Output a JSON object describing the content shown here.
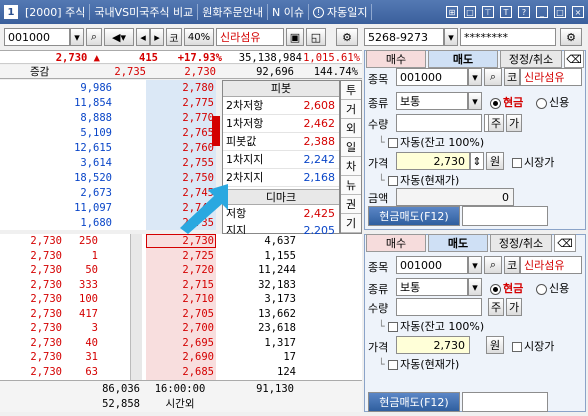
{
  "titlebar": {
    "win_no": "1",
    "screen": "[2000] 주식",
    "tabs": [
      "국내VS미국주식 비교",
      "원화주문안내",
      "N 이슈",
      "자동일지"
    ]
  },
  "toolbar": {
    "code": "001000",
    "stock_flag": "코",
    "margin": "40%",
    "stock_name": "신라섬유",
    "account": "5268-9273",
    "password": "********"
  },
  "summary": {
    "price": "2,730",
    "change": "415",
    "pct": "+17.93%",
    "volume": "35,138,984",
    "other": "1,015.61%",
    "label_change": "증감",
    "ref_price": "2,735",
    "cur_price": "2,730",
    "vol2": "92,696",
    "vol_ratio": "144.74%"
  },
  "asks": [
    {
      "qty": "9,986",
      "price": "2,780"
    },
    {
      "qty": "11,854",
      "price": "2,775"
    },
    {
      "qty": "8,888",
      "price": "2,770"
    },
    {
      "qty": "5,109",
      "price": "2,765"
    },
    {
      "qty": "12,615",
      "price": "2,760"
    },
    {
      "qty": "3,614",
      "price": "2,755"
    },
    {
      "qty": "18,520",
      "price": "2,750"
    },
    {
      "qty": "2,673",
      "price": "2,745"
    },
    {
      "qty": "11,097",
      "price": "2,740"
    },
    {
      "qty": "1,680",
      "price": "2,735"
    }
  ],
  "bids": [
    {
      "price": "2,730",
      "qty": "4,637"
    },
    {
      "price": "2,725",
      "qty": "1,155"
    },
    {
      "price": "2,720",
      "qty": "11,244"
    },
    {
      "price": "2,715",
      "qty": "32,183"
    },
    {
      "price": "2,710",
      "qty": "3,173"
    },
    {
      "price": "2,705",
      "qty": "13,662"
    },
    {
      "price": "2,700",
      "qty": "23,618"
    },
    {
      "price": "2,695",
      "qty": "1,317"
    },
    {
      "price": "2,690",
      "qty": "17"
    },
    {
      "price": "2,685",
      "qty": "124"
    }
  ],
  "trades": [
    {
      "price": "2,730",
      "qty": "250"
    },
    {
      "price": "2,730",
      "qty": "1"
    },
    {
      "price": "2,730",
      "qty": "50"
    },
    {
      "price": "2,730",
      "qty": "333"
    },
    {
      "price": "2,730",
      "qty": "100"
    },
    {
      "price": "2,730",
      "qty": "417"
    },
    {
      "price": "2,730",
      "qty": "3"
    },
    {
      "price": "2,730",
      "qty": "40"
    },
    {
      "price": "2,730",
      "qty": "31"
    },
    {
      "price": "2,730",
      "qty": "63"
    }
  ],
  "totals": {
    "ask_total": "86,036",
    "bid_total": "91,130",
    "time": "16:00:00",
    "after_qty": "52,858",
    "after_label": "시간외"
  },
  "pivot": {
    "title": "피봇",
    "rows": [
      {
        "label": "2차저항",
        "value": "2,608"
      },
      {
        "label": "1차저항",
        "value": "2,462"
      },
      {
        "label": "피봇값",
        "value": "2,388"
      },
      {
        "label": "1차지지",
        "value": "2,242"
      },
      {
        "label": "2차지지",
        "value": "2,168"
      }
    ],
    "demark_title": "디마크",
    "demark_rows": [
      {
        "label": "저항",
        "value": "2,425"
      },
      {
        "label": "지지",
        "value": "2,205"
      }
    ],
    "side_tabs": [
      "투",
      "거",
      "외",
      "일",
      "차",
      "뉴",
      "권",
      "기"
    ]
  },
  "order1": {
    "tabs": [
      "매수",
      "매도",
      "정정/취소"
    ],
    "code_label": "종목",
    "code": "001000",
    "flag": "코",
    "name": "신라섬유",
    "type_label": "종류",
    "type": "보통",
    "cash": "현금",
    "credit": "신용",
    "qty_label": "수량",
    "qty_btn1": "주",
    "qty_btn2": "가",
    "auto_qty": "자동(잔고 100%)",
    "price_label": "가격",
    "price": "2,730",
    "price_btn": "원",
    "market": "시장가",
    "auto_price": "자동(현재가)",
    "amount_label": "금액",
    "amount": "0",
    "submit": "현금매도(F12)"
  },
  "order2": {
    "tabs": [
      "매수",
      "매도",
      "정정/취소"
    ],
    "code_label": "종목",
    "code": "001000",
    "flag": "코",
    "name": "신라섬유",
    "type_label": "종류",
    "type": "보통",
    "cash": "현금",
    "credit": "신용",
    "qty_label": "수량",
    "qty_btn1": "주",
    "qty_btn2": "가",
    "auto_qty": "자동(잔고 100%)",
    "price_label": "가격",
    "price": "2,730",
    "price_btn": "원",
    "market": "시장가",
    "auto_price": "자동(현재가)",
    "submit": "현금매도(F12)"
  },
  "colors": {
    "ask_bg": "#dbe8f6",
    "bid_bg": "#f8dede",
    "accent": "#3a5f9c",
    "arrow": "#2aa8e0"
  }
}
